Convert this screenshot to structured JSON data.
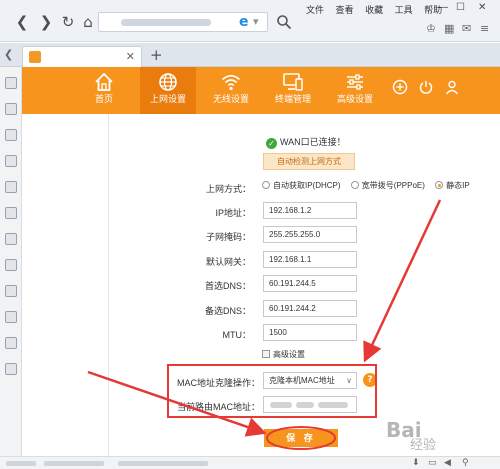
{
  "browser": {
    "menu": [
      "文件",
      "查看",
      "收藏",
      "工具",
      "帮助"
    ],
    "tab_title": "​"
  },
  "router_nav": [
    {
      "id": "home",
      "label": "首页",
      "icon": "house-icon"
    },
    {
      "id": "wan",
      "label": "上网设置",
      "icon": "globe-icon"
    },
    {
      "id": "wifi",
      "label": "无线设置",
      "icon": "wifi-icon"
    },
    {
      "id": "devices",
      "label": "终端管理",
      "icon": "devices-icon"
    },
    {
      "id": "advanced",
      "label": "高级设置",
      "icon": "sliders-icon"
    }
  ],
  "form": {
    "status_text": "WAN口已连接！",
    "detect_button": "自动检测上网方式",
    "mode_label": "上网方式：",
    "mode_options": [
      "自动获取IP(DHCP)",
      "宽带拨号(PPPoE)",
      "静态IP"
    ],
    "mode_selected": "静态IP",
    "ip_label": "IP地址：",
    "ip_value": "192.168.1.2",
    "mask_label": "子网掩码：",
    "mask_value": "255.255.255.0",
    "gateway_label": "默认网关：",
    "gateway_value": "192.168.1.1",
    "dns1_label": "首选DNS：",
    "dns1_value": "60.191.244.5",
    "dns2_label": "备选DNS：",
    "dns2_value": "60.191.244.2",
    "mtu_label": "MTU：",
    "mtu_value": "1500",
    "advanced_label": "高级设置",
    "mac_clone_label": "MAC地址克隆操作：",
    "mac_clone_value": "克隆本机MAC地址",
    "router_mac_label": "当前路由MAC地址：",
    "help_label": "?",
    "save_button": "保 存"
  },
  "watermark": {
    "main": "Bai",
    "sub": "经验"
  },
  "colors": {
    "brand_orange": "#f7941d",
    "annotation_red": "#e53935"
  }
}
